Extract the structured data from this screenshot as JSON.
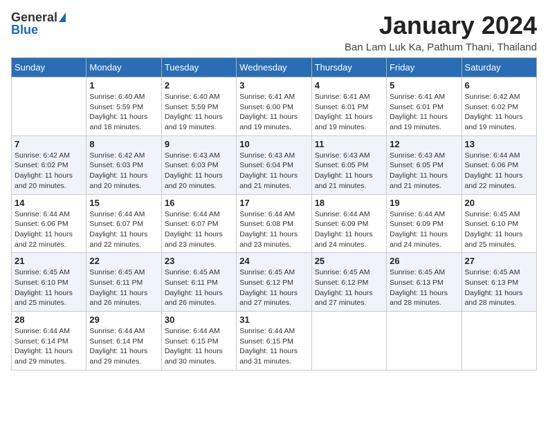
{
  "logo": {
    "general": "General",
    "blue": "Blue"
  },
  "header": {
    "month": "January 2024",
    "location": "Ban Lam Luk Ka, Pathum Thani, Thailand"
  },
  "weekdays": [
    "Sunday",
    "Monday",
    "Tuesday",
    "Wednesday",
    "Thursday",
    "Friday",
    "Saturday"
  ],
  "weeks": [
    [
      {
        "day": "",
        "sunrise": "",
        "sunset": "",
        "daylight": ""
      },
      {
        "day": "1",
        "sunrise": "Sunrise: 6:40 AM",
        "sunset": "Sunset: 5:59 PM",
        "daylight": "Daylight: 11 hours and 18 minutes."
      },
      {
        "day": "2",
        "sunrise": "Sunrise: 6:40 AM",
        "sunset": "Sunset: 5:59 PM",
        "daylight": "Daylight: 11 hours and 19 minutes."
      },
      {
        "day": "3",
        "sunrise": "Sunrise: 6:41 AM",
        "sunset": "Sunset: 6:00 PM",
        "daylight": "Daylight: 11 hours and 19 minutes."
      },
      {
        "day": "4",
        "sunrise": "Sunrise: 6:41 AM",
        "sunset": "Sunset: 6:01 PM",
        "daylight": "Daylight: 11 hours and 19 minutes."
      },
      {
        "day": "5",
        "sunrise": "Sunrise: 6:41 AM",
        "sunset": "Sunset: 6:01 PM",
        "daylight": "Daylight: 11 hours and 19 minutes."
      },
      {
        "day": "6",
        "sunrise": "Sunrise: 6:42 AM",
        "sunset": "Sunset: 6:02 PM",
        "daylight": "Daylight: 11 hours and 19 minutes."
      }
    ],
    [
      {
        "day": "7",
        "sunrise": "Sunrise: 6:42 AM",
        "sunset": "Sunset: 6:02 PM",
        "daylight": "Daylight: 11 hours and 20 minutes."
      },
      {
        "day": "8",
        "sunrise": "Sunrise: 6:42 AM",
        "sunset": "Sunset: 6:03 PM",
        "daylight": "Daylight: 11 hours and 20 minutes."
      },
      {
        "day": "9",
        "sunrise": "Sunrise: 6:43 AM",
        "sunset": "Sunset: 6:03 PM",
        "daylight": "Daylight: 11 hours and 20 minutes."
      },
      {
        "day": "10",
        "sunrise": "Sunrise: 6:43 AM",
        "sunset": "Sunset: 6:04 PM",
        "daylight": "Daylight: 11 hours and 21 minutes."
      },
      {
        "day": "11",
        "sunrise": "Sunrise: 6:43 AM",
        "sunset": "Sunset: 6:05 PM",
        "daylight": "Daylight: 11 hours and 21 minutes."
      },
      {
        "day": "12",
        "sunrise": "Sunrise: 6:43 AM",
        "sunset": "Sunset: 6:05 PM",
        "daylight": "Daylight: 11 hours and 21 minutes."
      },
      {
        "day": "13",
        "sunrise": "Sunrise: 6:44 AM",
        "sunset": "Sunset: 6:06 PM",
        "daylight": "Daylight: 11 hours and 22 minutes."
      }
    ],
    [
      {
        "day": "14",
        "sunrise": "Sunrise: 6:44 AM",
        "sunset": "Sunset: 6:06 PM",
        "daylight": "Daylight: 11 hours and 22 minutes."
      },
      {
        "day": "15",
        "sunrise": "Sunrise: 6:44 AM",
        "sunset": "Sunset: 6:07 PM",
        "daylight": "Daylight: 11 hours and 22 minutes."
      },
      {
        "day": "16",
        "sunrise": "Sunrise: 6:44 AM",
        "sunset": "Sunset: 6:07 PM",
        "daylight": "Daylight: 11 hours and 23 minutes."
      },
      {
        "day": "17",
        "sunrise": "Sunrise: 6:44 AM",
        "sunset": "Sunset: 6:08 PM",
        "daylight": "Daylight: 11 hours and 23 minutes."
      },
      {
        "day": "18",
        "sunrise": "Sunrise: 6:44 AM",
        "sunset": "Sunset: 6:09 PM",
        "daylight": "Daylight: 11 hours and 24 minutes."
      },
      {
        "day": "19",
        "sunrise": "Sunrise: 6:44 AM",
        "sunset": "Sunset: 6:09 PM",
        "daylight": "Daylight: 11 hours and 24 minutes."
      },
      {
        "day": "20",
        "sunrise": "Sunrise: 6:45 AM",
        "sunset": "Sunset: 6:10 PM",
        "daylight": "Daylight: 11 hours and 25 minutes."
      }
    ],
    [
      {
        "day": "21",
        "sunrise": "Sunrise: 6:45 AM",
        "sunset": "Sunset: 6:10 PM",
        "daylight": "Daylight: 11 hours and 25 minutes."
      },
      {
        "day": "22",
        "sunrise": "Sunrise: 6:45 AM",
        "sunset": "Sunset: 6:11 PM",
        "daylight": "Daylight: 11 hours and 26 minutes."
      },
      {
        "day": "23",
        "sunrise": "Sunrise: 6:45 AM",
        "sunset": "Sunset: 6:11 PM",
        "daylight": "Daylight: 11 hours and 26 minutes."
      },
      {
        "day": "24",
        "sunrise": "Sunrise: 6:45 AM",
        "sunset": "Sunset: 6:12 PM",
        "daylight": "Daylight: 11 hours and 27 minutes."
      },
      {
        "day": "25",
        "sunrise": "Sunrise: 6:45 AM",
        "sunset": "Sunset: 6:12 PM",
        "daylight": "Daylight: 11 hours and 27 minutes."
      },
      {
        "day": "26",
        "sunrise": "Sunrise: 6:45 AM",
        "sunset": "Sunset: 6:13 PM",
        "daylight": "Daylight: 11 hours and 28 minutes."
      },
      {
        "day": "27",
        "sunrise": "Sunrise: 6:45 AM",
        "sunset": "Sunset: 6:13 PM",
        "daylight": "Daylight: 11 hours and 28 minutes."
      }
    ],
    [
      {
        "day": "28",
        "sunrise": "Sunrise: 6:44 AM",
        "sunset": "Sunset: 6:14 PM",
        "daylight": "Daylight: 11 hours and 29 minutes."
      },
      {
        "day": "29",
        "sunrise": "Sunrise: 6:44 AM",
        "sunset": "Sunset: 6:14 PM",
        "daylight": "Daylight: 11 hours and 29 minutes."
      },
      {
        "day": "30",
        "sunrise": "Sunrise: 6:44 AM",
        "sunset": "Sunset: 6:15 PM",
        "daylight": "Daylight: 11 hours and 30 minutes."
      },
      {
        "day": "31",
        "sunrise": "Sunrise: 6:44 AM",
        "sunset": "Sunset: 6:15 PM",
        "daylight": "Daylight: 11 hours and 31 minutes."
      },
      {
        "day": "",
        "sunrise": "",
        "sunset": "",
        "daylight": ""
      },
      {
        "day": "",
        "sunrise": "",
        "sunset": "",
        "daylight": ""
      },
      {
        "day": "",
        "sunrise": "",
        "sunset": "",
        "daylight": ""
      }
    ]
  ]
}
